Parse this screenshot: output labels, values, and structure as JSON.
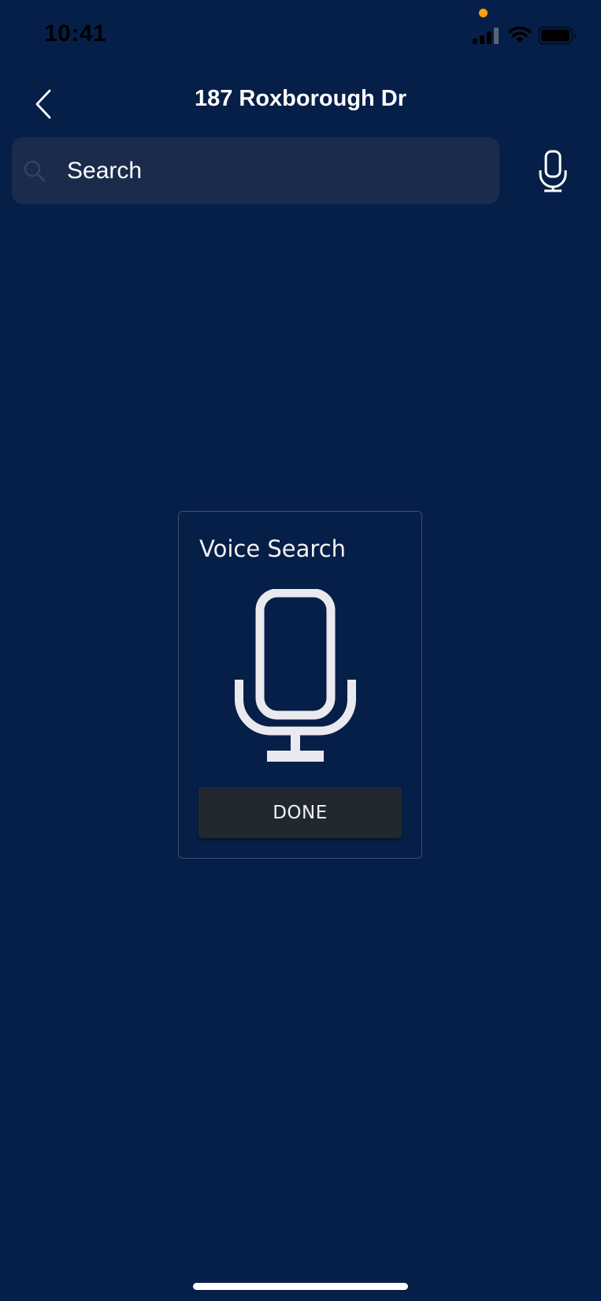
{
  "status_bar": {
    "time": "10:41"
  },
  "header": {
    "title": "187 Roxborough Dr",
    "back_icon": "chevron-left-icon"
  },
  "search": {
    "placeholder": "Search",
    "value": "",
    "search_icon": "search-icon",
    "voice_icon": "microphone-icon"
  },
  "voice_dialog": {
    "title": "Voice Search",
    "mic_icon": "microphone-icon",
    "done_label": "DONE"
  },
  "colors": {
    "background": "#061f48",
    "search_field": "#1a2b4c",
    "done_button": "#22282f",
    "privacy_dot": "#ff9f0a"
  }
}
